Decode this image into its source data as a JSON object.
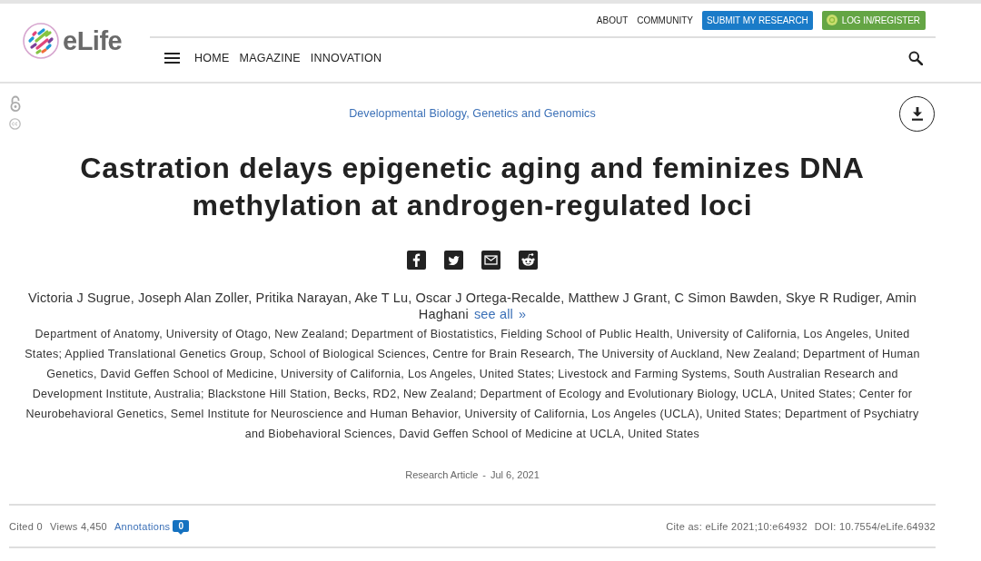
{
  "header": {
    "logo": {
      "text": "eLife"
    },
    "top_links": [
      {
        "label": "ABOUT",
        "kind": "link"
      },
      {
        "label": "COMMUNITY",
        "kind": "link"
      },
      {
        "label": "SUBMIT MY RESEARCH",
        "kind": "primary"
      },
      {
        "label": "LOG IN/REGISTER",
        "kind": "login"
      }
    ],
    "nav": [
      "HOME",
      "MAGAZINE",
      "INNOVATION"
    ]
  },
  "article": {
    "subject": "Developmental Biology, Genetics and Genomics",
    "title": "Castration delays epigenetic aging and feminizes DNA methylation at androgen-regulated loci",
    "authors": "Victoria J Sugrue, Joseph Alan Zoller, Pritika Narayan, Ake T Lu, Oscar J Ortega-Recalde, Matthew J Grant, C Simon Bawden, Skye R Rudiger, Amin Haghani",
    "see_all": "see all",
    "see_all_arrow": "»",
    "affiliations": "Department of Anatomy, University of Otago, New Zealand; Department of Biostatistics, Fielding School of Public Health, University of California, Los Angeles, United States; Applied Translational Genetics Group, School of Biological Sciences, Centre for Brain Research, The University of Auckland, New Zealand; Department of Human Genetics, David Geffen School of Medicine, University of California, Los Angeles, United States; Livestock and Farming Systems, South Australian Research and Development Institute, Australia; Blackstone Hill Station, Becks, RD2, New Zealand; Department of Ecology and Evolutionary Biology, UCLA, United States; Center for Neurobehavioral Genetics, Semel Institute for Neuroscience and Human Behavior, University of California, Los Angeles (UCLA), United States; Department of Psychiatry and Biobehavioral Sciences, David Geffen School of Medicine at UCLA, United States",
    "article_type": "Research Article",
    "separator": "-",
    "date": "Jul 6, 2021"
  },
  "metrics": {
    "cited": "Cited 0",
    "views": "Views 4,450",
    "annotations": "Annotations",
    "annotation_count": "0",
    "cite_as": "Cite as: eLife 2021;10:e64932",
    "doi": "DOI: 10.7554/eLife.64932"
  }
}
